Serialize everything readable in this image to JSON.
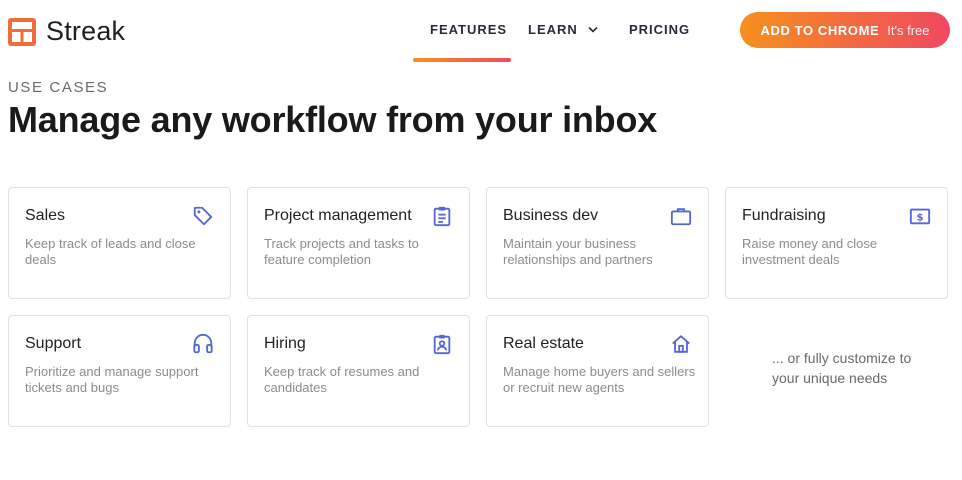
{
  "header": {
    "logo_text": "Streak",
    "nav": {
      "features": "FEATURES",
      "learn": "LEARN",
      "pricing": "PRICING"
    },
    "cta": {
      "main": "ADD TO CHROME",
      "sub": "It's free"
    }
  },
  "hero": {
    "eyebrow": "USE CASES",
    "title": "Manage any workflow from your inbox"
  },
  "cards": [
    {
      "title": "Sales",
      "desc": "Keep track of leads and close deals",
      "icon": "tag-icon"
    },
    {
      "title": "Project management",
      "desc": "Track projects and tasks to feature completion",
      "icon": "clipboard-list-icon"
    },
    {
      "title": "Business dev",
      "desc": "Maintain your business relationships and partners",
      "icon": "briefcase-icon"
    },
    {
      "title": "Fundraising",
      "desc": "Raise money and close investment deals",
      "icon": "dollar-bill-icon"
    },
    {
      "title": "Support",
      "desc": "Prioritize and manage support tickets and bugs",
      "icon": "headphones-icon"
    },
    {
      "title": "Hiring",
      "desc": "Keep track of resumes and candidates",
      "icon": "id-badge-icon"
    },
    {
      "title": "Real estate",
      "desc": "Manage home buyers and sellers or recruit new agents",
      "icon": "house-icon"
    }
  ],
  "more": "... or fully customize to your unique needs",
  "colors": {
    "brand_orange": "#f7901d",
    "brand_red": "#ef4860",
    "icon_blue": "#5468d4"
  }
}
